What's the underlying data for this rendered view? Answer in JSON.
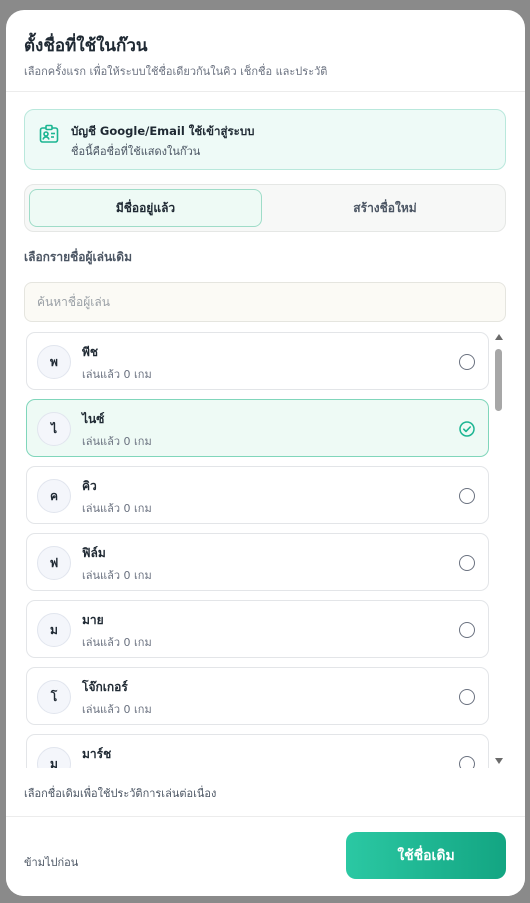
{
  "header": {
    "title": "ตั้งชื่อที่ใช้ในก๊วน",
    "subtitle": "เลือกครั้งแรก เพื่อให้ระบบใช้ชื่อเดียวกันในคิว เช็กชื่อ และประวัติ"
  },
  "info": {
    "icon": "id-card-icon",
    "title": "บัญชี Google/Email ใช้เข้าสู่ระบบ",
    "subtitle": "ชื่อนี้คือชื่อที่ใช้แสดงในก๊วน"
  },
  "tabs": [
    {
      "label": "มีชื่ออยู่แล้ว",
      "active": true
    },
    {
      "label": "สร้างชื่อใหม่",
      "active": false
    }
  ],
  "section_label": "เลือกรายชื่อผู้เล่นเดิม",
  "search": {
    "placeholder": "ค้นหาชื่อผู้เล่น",
    "value": ""
  },
  "players": [
    {
      "initial": "พ",
      "name": "พีช",
      "stats": "เล่นแล้ว 0 เกม",
      "selected": false
    },
    {
      "initial": "ไ",
      "name": "ไนซ์",
      "stats": "เล่นแล้ว 0 เกม",
      "selected": true
    },
    {
      "initial": "ค",
      "name": "คิว",
      "stats": "เล่นแล้ว 0 เกม",
      "selected": false
    },
    {
      "initial": "ฟ",
      "name": "ฟิล์ม",
      "stats": "เล่นแล้ว 0 เกม",
      "selected": false
    },
    {
      "initial": "ม",
      "name": "มาย",
      "stats": "เล่นแล้ว 0 เกม",
      "selected": false
    },
    {
      "initial": "โ",
      "name": "โจ๊กเกอร์",
      "stats": "เล่นแล้ว 0 เกม",
      "selected": false
    },
    {
      "initial": "ม",
      "name": "มาร์ช",
      "stats": "",
      "selected": false
    }
  ],
  "hint": "เลือกชื่อเดิมเพื่อใช้ประวัติการเล่นต่อเนื่อง",
  "footer": {
    "skip_label": "ข้ามไปก่อน",
    "primary_label": "ใช้ชื่อเดิม"
  },
  "colors": {
    "accent": "#1bb592",
    "accent_light": "#eefaf5",
    "accent_border": "#80d6bb"
  }
}
